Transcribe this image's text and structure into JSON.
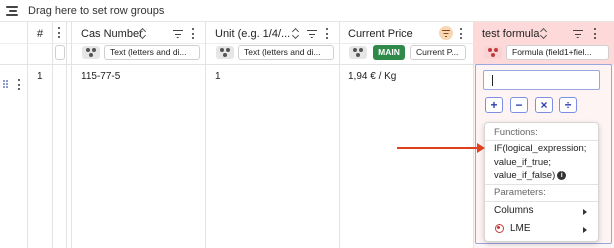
{
  "group_bar": {
    "label": "Drag here to set row groups",
    "icon": "row-groups-icon"
  },
  "columns": {
    "index": {
      "label": "#"
    },
    "cas": {
      "label": "Cas Number",
      "filter_type": "Text (letters and di..."
    },
    "unit": {
      "label": "Unit (e.g. 1/4/...",
      "filter_type": "Text (letters and di..."
    },
    "price": {
      "label": "Current Price",
      "badge": "MAIN",
      "filter_type": "Current P..."
    },
    "formula": {
      "label": "test formula",
      "filter_type": "Formula (field1+fiel..."
    }
  },
  "row": {
    "index": "1",
    "cas": "115-77-5",
    "unit": "1",
    "price": "1,94 € / Kg"
  },
  "editor": {
    "input_value": "",
    "operators": [
      "+",
      "−",
      "×",
      "÷"
    ],
    "popup": {
      "functions_header": "Functions:",
      "function_signature": "IF(logical_expression; value_if_true; value_if_false)",
      "info_glyph": "i",
      "parameters_header": "Parameters:",
      "items": [
        {
          "label": "Columns",
          "has_submenu": true
        },
        {
          "label": "LME",
          "has_submenu": true,
          "icon": "lme-icon"
        }
      ]
    }
  },
  "colors": {
    "formula_header_bg": "#fdd9d9",
    "formula_column_bg": "#fff4f4",
    "main_badge": "#2f8a4a",
    "operator_accent": "#2b3fae",
    "arrow": "#e0411f"
  }
}
